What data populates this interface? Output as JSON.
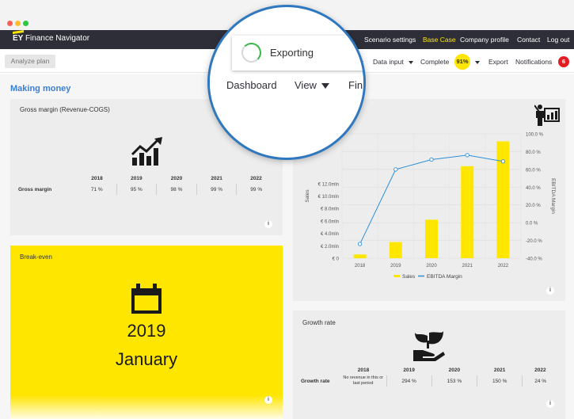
{
  "app": {
    "logo_brand": "EY",
    "logo_name": "Finance Navigator"
  },
  "window_dots": [
    "#ff5f56",
    "#ffbd2e",
    "#27c93f"
  ],
  "nav": {
    "scenario": "Scenario settings",
    "base_case": "Base Case",
    "company": "Company profile",
    "contact": "Contact",
    "logout": "Log out"
  },
  "toolbar": {
    "analyze": "Analyze plan",
    "data_input": "Data input",
    "complete": "Complete",
    "complete_pct": "91%",
    "export": "Export",
    "notifications": "Notifications",
    "notif_count": "6"
  },
  "magnifier": {
    "dialog": "Exporting",
    "dashboard": "Dashboard",
    "view": "View",
    "fin": "Fin"
  },
  "section": {
    "title": "Making money"
  },
  "gross_margin": {
    "title": "Gross margin (Revenue-COGS)",
    "row_label": "Gross margin",
    "years": [
      "2018",
      "2019",
      "2020",
      "2021",
      "2022"
    ],
    "values": [
      "71 %",
      "95 %",
      "98 %",
      "99 %",
      "99 %"
    ],
    "info": "i"
  },
  "breakeven": {
    "title": "Break-even",
    "year": "2019",
    "month": "January",
    "info": "i"
  },
  "growth": {
    "title": "Growth rate",
    "row_label": "Growth rate",
    "years": [
      "2018",
      "2019",
      "2020",
      "2021",
      "2022"
    ],
    "values": [
      "No revenue in this or last period",
      "294 %",
      "153 %",
      "150 %",
      "24 %"
    ],
    "info": "i"
  },
  "sales_chart": {
    "info": "i"
  },
  "colors": {
    "yellow": "#ffe600",
    "dark": "#2e2e38",
    "blue": "#3a7fd5",
    "line": "#2e8fd6",
    "red": "#e31b23"
  },
  "chart_data": {
    "type": "bar",
    "categories": [
      "2018",
      "2019",
      "2020",
      "2021",
      "2022"
    ],
    "series": [
      {
        "name": "Sales",
        "type": "bar",
        "axis": "left",
        "values": [
          0.6,
          2.6,
          6.2,
          14.8,
          18.8
        ]
      },
      {
        "name": "EBITDA Margin",
        "type": "line",
        "axis": "right",
        "values": [
          -24,
          60,
          71,
          76,
          69
        ]
      }
    ],
    "ylabel": "Sales",
    "y2label": "EBITDA Margin",
    "y_ticks": [
      "€ 0",
      "€ 2.0mln",
      "€ 4.0mln",
      "€ 6.0mln",
      "€ 8.0mln",
      "€ 10.0mln",
      "€ 12.0mln"
    ],
    "y_tick_values": [
      0,
      2,
      4,
      6,
      8,
      10,
      12
    ],
    "ylim": [
      0,
      20
    ],
    "y2_ticks": [
      "-40.0 %",
      "-20.0 %",
      "0.0 %",
      "20.0 %",
      "40.0 %",
      "60.0 %",
      "80.0 %",
      "100.0 %"
    ],
    "y2_tick_values": [
      -40,
      -20,
      0,
      20,
      40,
      60,
      80,
      100
    ],
    "y2lim": [
      -40,
      100
    ],
    "legend_position": "bottom",
    "grid": true
  }
}
